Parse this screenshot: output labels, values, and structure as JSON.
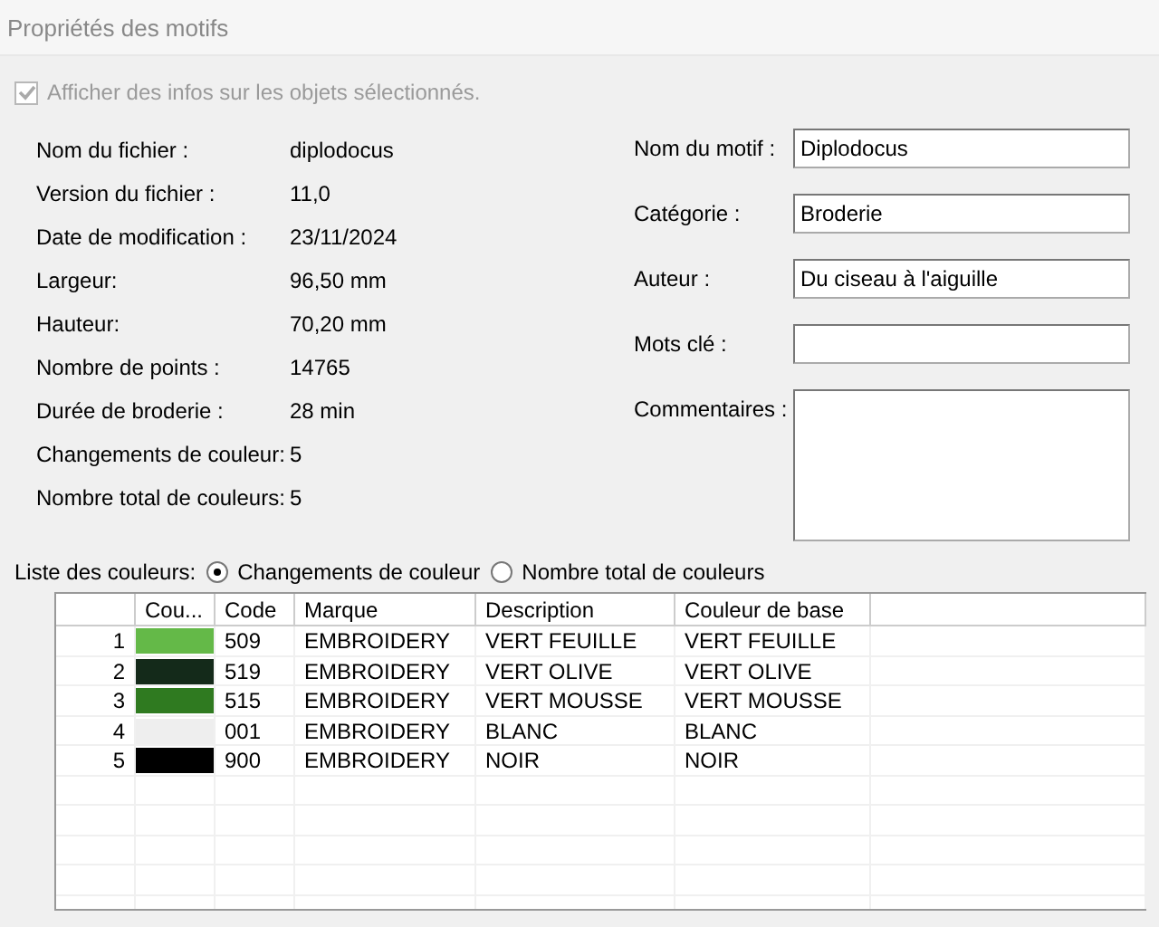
{
  "window": {
    "title": "Propriétés des motifs"
  },
  "show_info": {
    "label": "Afficher des infos sur les objets sélectionnés.",
    "checked": true,
    "disabled": true
  },
  "info": [
    {
      "label": "Nom du fichier :",
      "value": "diplodocus"
    },
    {
      "label": "Version du fichier :",
      "value": "11,0"
    },
    {
      "label": "Date de modification :",
      "value": "23/11/2024"
    },
    {
      "label": "Largeur:",
      "value": "96,50 mm"
    },
    {
      "label": "Hauteur:",
      "value": "70,20 mm"
    },
    {
      "label": "Nombre de points :",
      "value": "14765"
    },
    {
      "label": "Durée de broderie :",
      "value": "28 min"
    },
    {
      "label": "Changements de couleur:",
      "value": "5"
    },
    {
      "label": "Nombre total de couleurs:",
      "value": "5"
    }
  ],
  "fields": [
    {
      "label": "Nom du motif :",
      "value": "Diplodocus",
      "kind": "input"
    },
    {
      "label": "Catégorie :",
      "value": "Broderie",
      "kind": "input"
    },
    {
      "label": "Auteur :",
      "value": "Du ciseau à l'aiguille",
      "kind": "input"
    },
    {
      "label": "Mots clé :",
      "kind": "input"
    },
    {
      "label": "Commentaires :",
      "kind": "textarea"
    }
  ],
  "color_list": {
    "label": "Liste des couleurs:",
    "options": [
      {
        "label": "Changements de couleur",
        "selected": true
      },
      {
        "label": "Nombre total de couleurs",
        "selected": false
      }
    ]
  },
  "table": {
    "columns": [
      "Cou...",
      "Code",
      "Marque",
      "Description",
      "Couleur de base"
    ],
    "rows": [
      {
        "index": "1",
        "color": "#64b948",
        "code": "509",
        "brand": "EMBROIDERY",
        "description": "VERT FEUILLE",
        "base": "VERT FEUILLE"
      },
      {
        "index": "2",
        "color": "#142a1a",
        "code": "519",
        "brand": "EMBROIDERY",
        "description": "VERT OLIVE",
        "base": "VERT OLIVE"
      },
      {
        "index": "3",
        "color": "#2f7a20",
        "code": "515",
        "brand": "EMBROIDERY",
        "description": "VERT MOUSSE",
        "base": "VERT MOUSSE"
      },
      {
        "index": "4",
        "color": "#eeeeee",
        "code": "001",
        "brand": "EMBROIDERY",
        "description": "BLANC",
        "base": "BLANC"
      },
      {
        "index": "5",
        "color": "#000000",
        "code": "900",
        "brand": "EMBROIDERY",
        "description": "NOIR",
        "base": "NOIR"
      }
    ]
  }
}
